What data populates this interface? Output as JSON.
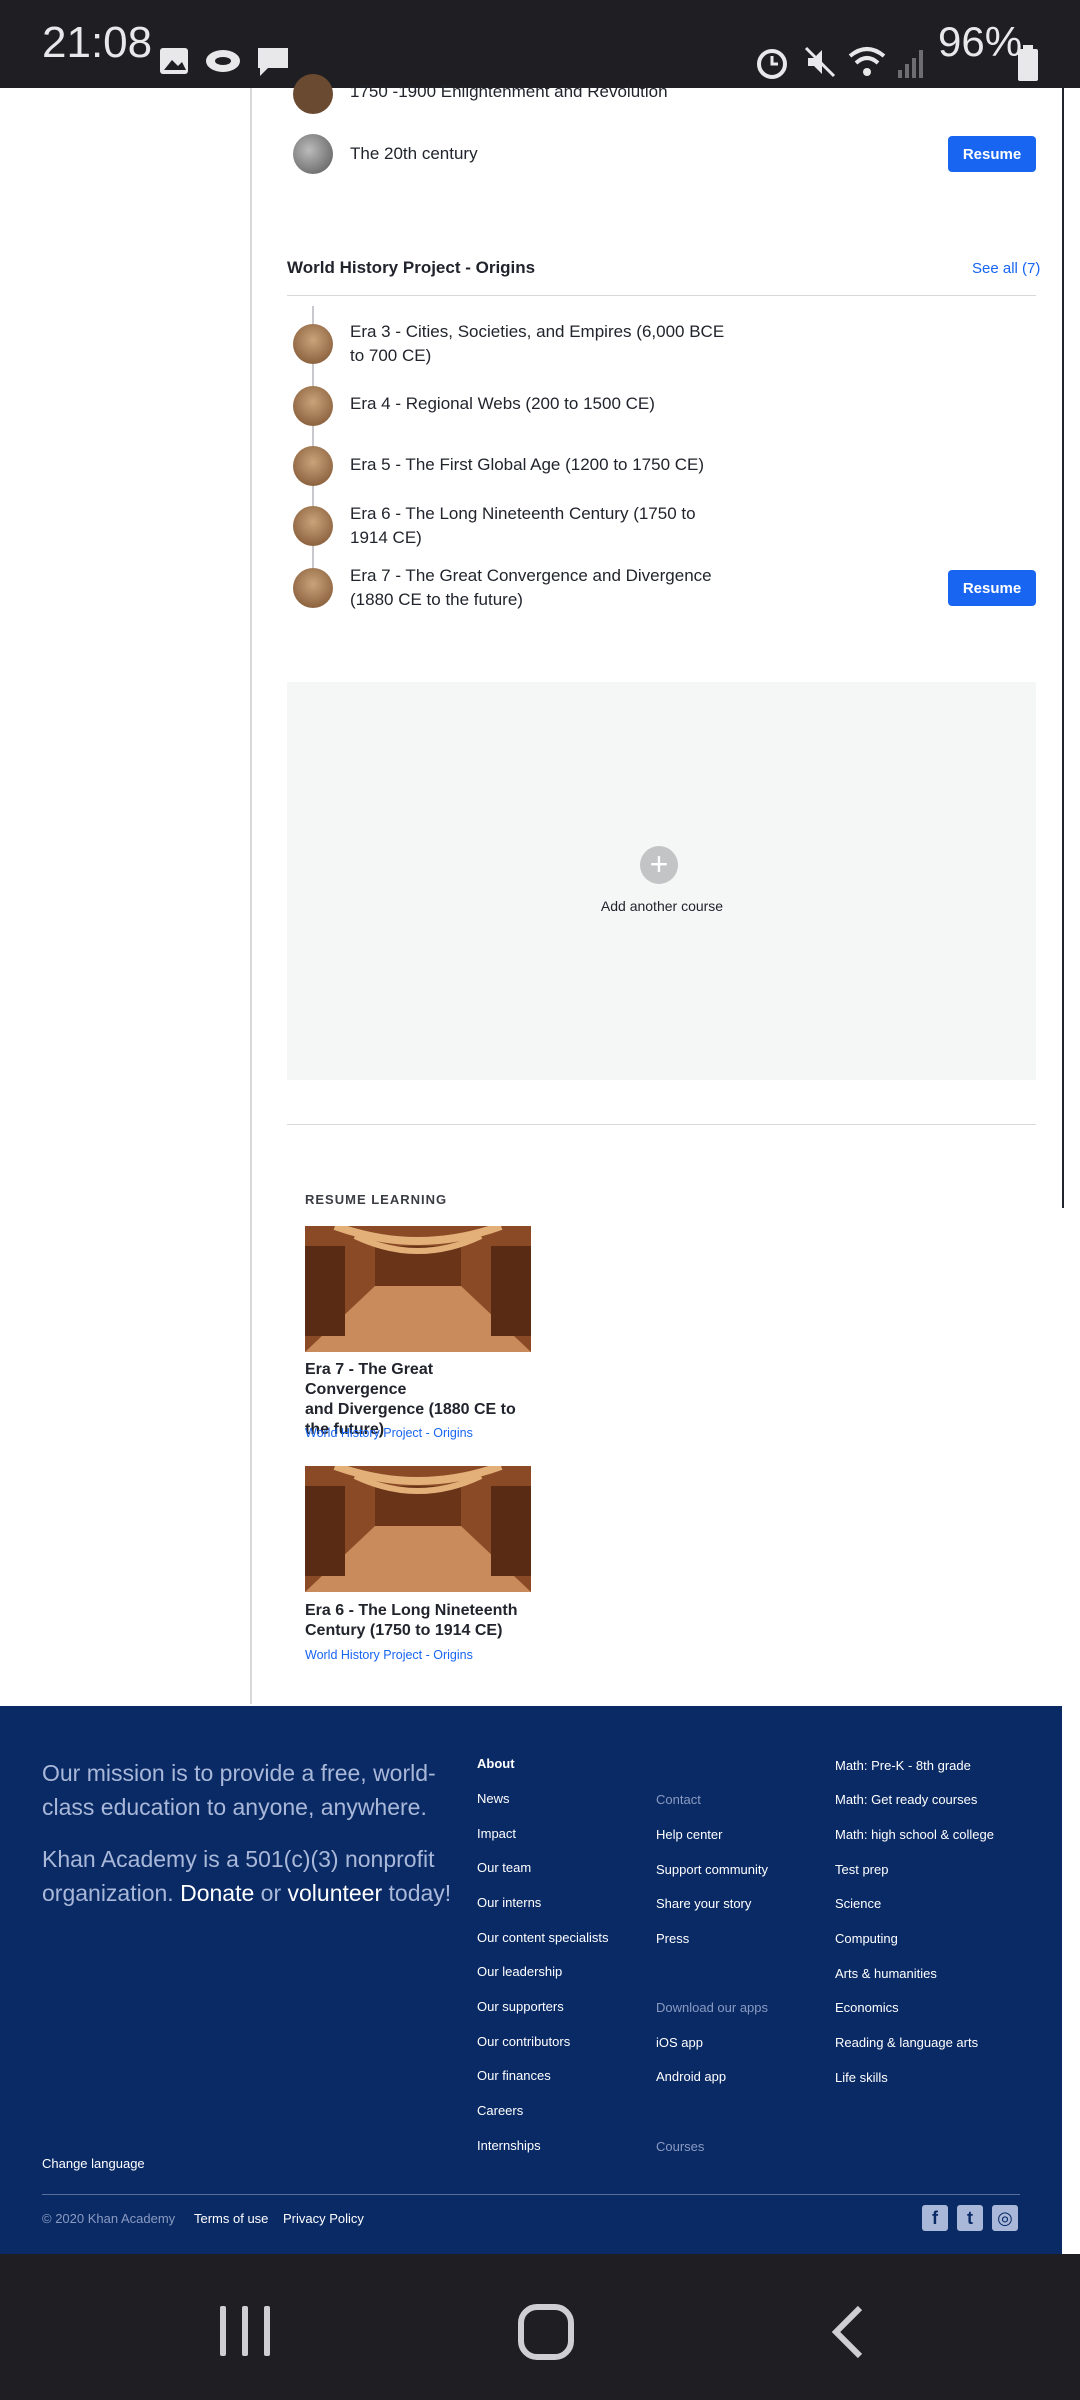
{
  "status_bar": {
    "time": "21:08",
    "battery": "96%",
    "icons": [
      "image-icon",
      "cloud-icon",
      "message-icon",
      "alarm-icon",
      "mute-icon",
      "wifi-icon",
      "signal-icon",
      "battery-icon"
    ]
  },
  "units_top": [
    {
      "label": "1750 -1900 Enlightenment and Revolution"
    },
    {
      "label": "The 20th century",
      "button": "Resume"
    }
  ],
  "course": {
    "title": "World History Project - Origins",
    "see_all": "See all (7)",
    "units": [
      {
        "label_line1": "Era 3 - Cities, Societies, and Empires (6,000 BCE",
        "label_line2": "to 700 CE)"
      },
      {
        "label_line1": "Era 4 - Regional Webs (200 to 1500 CE)",
        "label_line2": ""
      },
      {
        "label_line1": "Era 5 - The First Global Age (1200 to 1750 CE)",
        "label_line2": ""
      },
      {
        "label_line1": "Era 6 - The Long Nineteenth Century (1750 to",
        "label_line2": "1914 CE)"
      },
      {
        "label_line1": "Era 7 - The Great Convergence and Divergence",
        "label_line2": "(1880 CE to the future)"
      }
    ],
    "resume_button": "Resume"
  },
  "add_course": {
    "label": "Add another course"
  },
  "resume_learning": {
    "heading": "RESUME LEARNING",
    "cards": [
      {
        "title_lines": [
          "Era 7 - The Great Convergence",
          "and Divergence (1880 CE to",
          "the future)"
        ],
        "course": "World History Project - Origins"
      },
      {
        "title_lines": [
          "Era 6 - The Long Nineteenth",
          "Century (1750 to 1914 CE)"
        ],
        "course": "World History Project - Origins"
      }
    ]
  },
  "footer": {
    "mission_1": "Our mission is to provide a free, world-class education to anyone, anywhere.",
    "mission_2a": "Khan Academy is a 501(c)(3) nonprofit organization.",
    "donate": "Donate",
    "or": "or",
    "volunteer": "volunteer",
    "today": "today!",
    "about_heading": "About",
    "about_links": [
      "News",
      "Impact",
      "Our team",
      "Our interns",
      "Our content specialists",
      "Our leadership",
      "Our supporters",
      "Our contributors",
      "Our finances",
      "Careers",
      "Internships"
    ],
    "contact_heading": "Contact",
    "contact_links": [
      "Help center",
      "Support community",
      "Share your story",
      "Press"
    ],
    "apps_heading": "Download our apps",
    "apps_links": [
      "iOS app",
      "Android app"
    ],
    "courses_heading": "Courses",
    "subject_links": [
      "Math: Pre-K - 8th grade",
      "Math: Get ready courses",
      "Math: high school & college",
      "Test prep",
      "Science",
      "Computing",
      "Arts & humanities",
      "Economics",
      "Reading & language arts",
      "Life skills"
    ],
    "change_language": "Change language",
    "copyright": "© 2020 Khan Academy",
    "terms": "Terms of use",
    "privacy": "Privacy Policy"
  },
  "colors": {
    "accent": "#1865f2",
    "footer_bg": "#0a2a66",
    "system_bar": "#1f1f23"
  }
}
